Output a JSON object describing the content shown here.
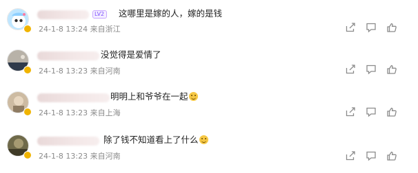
{
  "comments": [
    {
      "level_badge": "LV2",
      "text": "这哪里是嫁的人，嫁的是钱",
      "meta": "24-1-8 13:24 来自浙江",
      "avatar_color": "#bfe6ff"
    },
    {
      "text": "没觉得是爱情了",
      "meta": "24-1-8 13:23 来自河南",
      "avatar_color": "#b8b2a8"
    },
    {
      "text": "明明上和爷爷在一起",
      "meta": "24-1-8 13:23 来自上海",
      "avatar_color": "#cdbba2",
      "emoji": "grin-emoji"
    },
    {
      "text": "除了钱不知道看上了什么",
      "meta": "24-1-8 13:23 来自河南",
      "avatar_color": "#6f6a4a",
      "emoji": "grin-emoji"
    }
  ],
  "icons": {
    "share": "share-icon",
    "reply": "comment-icon",
    "like": "thumbs-up-icon"
  }
}
